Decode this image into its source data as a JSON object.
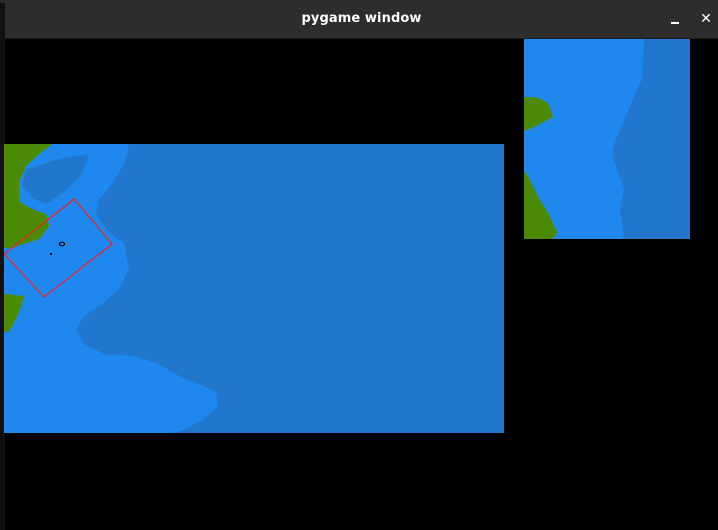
{
  "window": {
    "title": "pygame window",
    "minimize_glyph": "",
    "close_glyph": "✕"
  },
  "icons": {
    "minimize": "minimize-icon",
    "close": "close-icon"
  },
  "colors": {
    "deep_water": "#2277cc",
    "shallow_water": "#1f88ee",
    "land": "#4a8a04",
    "viewport_outline": "#ee2222",
    "titlebar": "#2d2d2d",
    "canvas_bg": "#000000"
  }
}
